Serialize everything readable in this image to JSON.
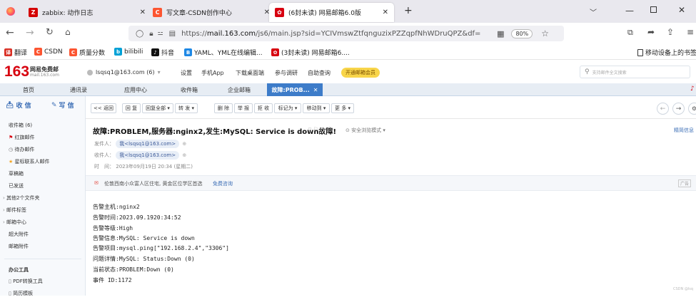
{
  "browser": {
    "tabs": [
      {
        "label": "zabbix: 动作日志",
        "color": "#d40000",
        "glyph": "Z"
      },
      {
        "label": "写文章-CSDN创作中心",
        "color": "#fc5531",
        "glyph": "C"
      },
      {
        "label": "(6封未读) 网易邮箱6.0版",
        "color": "#d7000f",
        "glyph": "✿"
      }
    ],
    "new_tab": "+",
    "url_host": "mail.163.com",
    "url_prefix": "https://",
    "url_suffix": "/js6/main.jsp?sid=YCIVmswZtfqnguzixPZZqpfNhWDruQPZ&df=",
    "zoom": "80%"
  },
  "bookmarks": [
    {
      "label": "翻译",
      "color": "#d93025",
      "glyph": "译"
    },
    {
      "label": "CSDN",
      "color": "#fc5531",
      "glyph": "C"
    },
    {
      "label": "质量分数",
      "color": "#fc5531",
      "glyph": "C"
    },
    {
      "label": "bilibili",
      "color": "#00a1d6",
      "glyph": "b"
    },
    {
      "label": "抖音",
      "color": "#111111",
      "glyph": "♪"
    },
    {
      "label": "YAML、YML在线编辑...",
      "color": "#1e88e5",
      "glyph": "B"
    },
    {
      "label": "(3封未读) 网易邮箱6....",
      "color": "#d7000f",
      "glyph": "✿"
    }
  ],
  "mobile_bookmarks": "移动设备上的书签",
  "mail": {
    "logo_num": "163",
    "logo_name": "网易免费邮",
    "logo_domain": "mail.163.com",
    "account": "lsqsq1@163.com (6)",
    "header_links": [
      "设置",
      "手机App",
      "下载桌面端",
      "参与调研",
      "自助查询"
    ],
    "vip_badge": "开通邮箱会员",
    "search_placeholder": "支持邮件全文搜索",
    "tabs": [
      "首页",
      "通讯录",
      "应用中心",
      "收件箱",
      "企业邮箱"
    ],
    "active_tab": "故障:PROB...",
    "receive": "收 信",
    "compose": "写 信",
    "sidebar": [
      "收件箱 (6)",
      "红旗邮件",
      "待办邮件",
      "星标联系人邮件",
      "草稿箱",
      "已发送",
      "其他2个文件夹",
      "邮件标签",
      "邮箱中心",
      "超大附件",
      "邮箱附件",
      "办公工具",
      "PDF转换工具",
      "简历模板"
    ],
    "toolbar": [
      "<< 返回",
      "回 复",
      "回复全部 ▾",
      "转 发 ▾",
      "删 除",
      "举 报",
      "拒 收",
      "标记为 ▾",
      "移动到 ▾",
      "更 多 ▾"
    ],
    "subject": "故障:PROBLEM,服务器:nginx2,发生:MySQL: Service is down故障!",
    "safe_mode": "安全浏览模式 ▾",
    "simple_info": "精简信息",
    "from_label": "发件人：",
    "from_value": "我<lsqsq1@163.com>",
    "to_label": "收件人：",
    "to_value": "我<lsqsq1@163.com>",
    "time_label": "时　间：",
    "time_value": "2023年09月19日 20:34 (星期二)",
    "ad_text": "伦敦西南小众富人区住宅, 黄金区位学区首选",
    "ad_link": "免费咨询",
    "ad_tag": "广告",
    "body": [
      "告警主机:nginx2",
      "告警时间:2023.09.1920:34:52",
      "告警等级:High",
      "告警信息:MySQL: Service is down",
      "告警项目:mysql.ping[\"192.168.2.4\",\"3306\"]",
      "问题详情:MySQL: Status:Down (0)",
      "当前状态:PROBLEM:Down (0)",
      "事件 ID:1172"
    ],
    "watermark": "CSDN @lsq"
  }
}
